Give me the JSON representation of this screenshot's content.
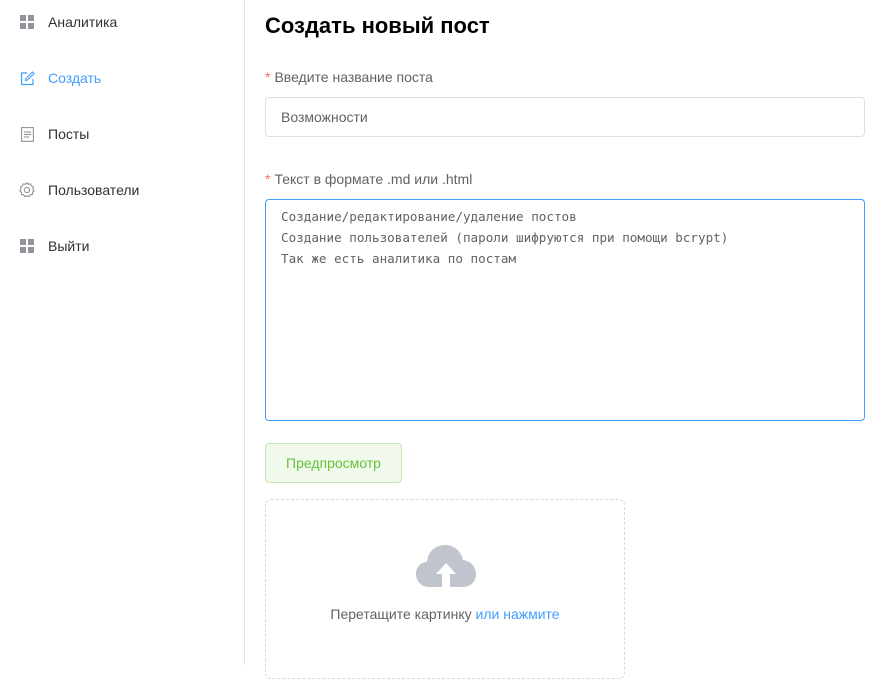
{
  "sidebar": {
    "items": [
      {
        "label": "Аналитика",
        "icon": "grid-icon"
      },
      {
        "label": "Создать",
        "icon": "edit-icon",
        "active": true
      },
      {
        "label": "Посты",
        "icon": "document-icon"
      },
      {
        "label": "Пользователи",
        "icon": "gear-icon"
      },
      {
        "label": "Выйти",
        "icon": "grid-icon"
      }
    ]
  },
  "form": {
    "title": "Создать новый пост",
    "required_mark": "*",
    "name_label": "Введите название поста",
    "name_value": "Возможности",
    "text_label": "Текст в формате .md или .html",
    "text_value": "Создание/редактирование/удаление постов\nСоздание пользователей (пароли шифруются при помощи bcrypt)\nТак же есть аналитика по постам",
    "preview_button": "Предпросмотр",
    "upload_hint": "Перетащите картинку",
    "upload_link": "или нажмите"
  },
  "colors": {
    "accent": "#409eff",
    "success": "#67c23a",
    "required": "#f56c6c",
    "border": "#dcdfe6"
  }
}
